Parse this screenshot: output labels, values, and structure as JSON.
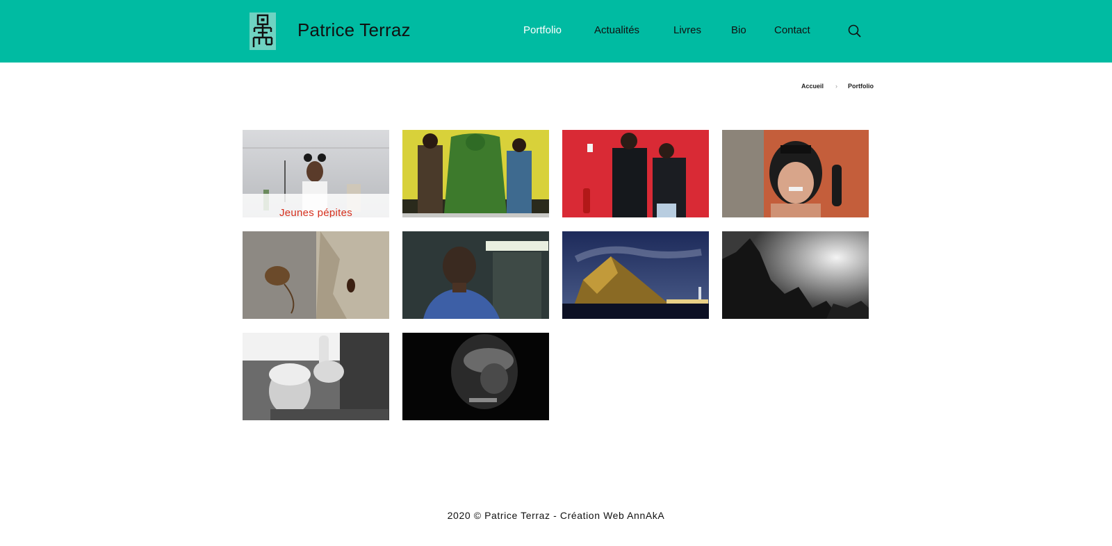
{
  "header": {
    "site_title": "Patrice Terraz",
    "nav": [
      {
        "label": "Portfolio",
        "active": true
      },
      {
        "label": "Actualités",
        "active": false
      },
      {
        "label": "Livres",
        "active": false
      },
      {
        "label": "Bio",
        "active": false
      },
      {
        "label": "Contact",
        "active": false
      }
    ],
    "search_icon": "search-icon",
    "logo_icon": "robot-figure-logo"
  },
  "breadcrumb": {
    "home": "Accueil",
    "separator": "›",
    "current": "Portfolio"
  },
  "gallery": {
    "tiles": [
      {
        "caption": "Jeunes pépites"
      },
      {
        "caption": ""
      },
      {
        "caption": ""
      },
      {
        "caption": ""
      },
      {
        "caption": ""
      },
      {
        "caption": ""
      },
      {
        "caption": ""
      },
      {
        "caption": ""
      },
      {
        "caption": ""
      },
      {
        "caption": ""
      }
    ]
  },
  "footer": {
    "text": "2020 © Patrice Terraz - Création Web AnnAkA"
  },
  "colors": {
    "header_bg": "#00bba2",
    "nav_active": "#ffffff",
    "caption_red": "#d6301e"
  }
}
